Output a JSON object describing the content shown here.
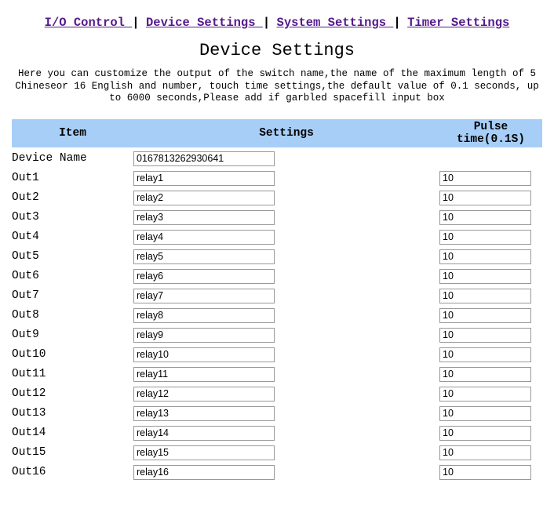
{
  "nav": {
    "links": [
      "I/O Control ",
      "Device Settings ",
      "System Settings ",
      "Timer Settings"
    ],
    "sep": "|"
  },
  "page_title": "Device Settings",
  "description": "Here you can customize the output of the switch name,the name of the maximum length of 5 Chineseor 16 English and number, touch time settings,the default value of 0.1 seconds, up to 6000 seconds,Please add if garbled spacefill input box",
  "columns": {
    "item": "Item",
    "settings": "Settings",
    "pulse": "Pulse time(0.1S)"
  },
  "device_name_row": {
    "label": "Device Name",
    "value": "0167813262930641"
  },
  "rows": [
    {
      "label": "Out1",
      "setting": "relay1",
      "pulse": "10"
    },
    {
      "label": "Out2",
      "setting": "relay2",
      "pulse": "10"
    },
    {
      "label": "Out3",
      "setting": "relay3",
      "pulse": "10"
    },
    {
      "label": "Out4",
      "setting": "relay4",
      "pulse": "10"
    },
    {
      "label": "Out5",
      "setting": "relay5",
      "pulse": "10"
    },
    {
      "label": "Out6",
      "setting": "relay6",
      "pulse": "10"
    },
    {
      "label": "Out7",
      "setting": "relay7",
      "pulse": "10"
    },
    {
      "label": "Out8",
      "setting": "relay8",
      "pulse": "10"
    },
    {
      "label": "Out9",
      "setting": "relay9",
      "pulse": "10"
    },
    {
      "label": "Out10",
      "setting": "relay10",
      "pulse": "10"
    },
    {
      "label": "Out11",
      "setting": "relay11",
      "pulse": "10"
    },
    {
      "label": "Out12",
      "setting": "relay12",
      "pulse": "10"
    },
    {
      "label": "Out13",
      "setting": "relay13",
      "pulse": "10"
    },
    {
      "label": "Out14",
      "setting": "relay14",
      "pulse": "10"
    },
    {
      "label": "Out15",
      "setting": "relay15",
      "pulse": "10"
    },
    {
      "label": "Out16",
      "setting": "relay16",
      "pulse": "10"
    }
  ]
}
